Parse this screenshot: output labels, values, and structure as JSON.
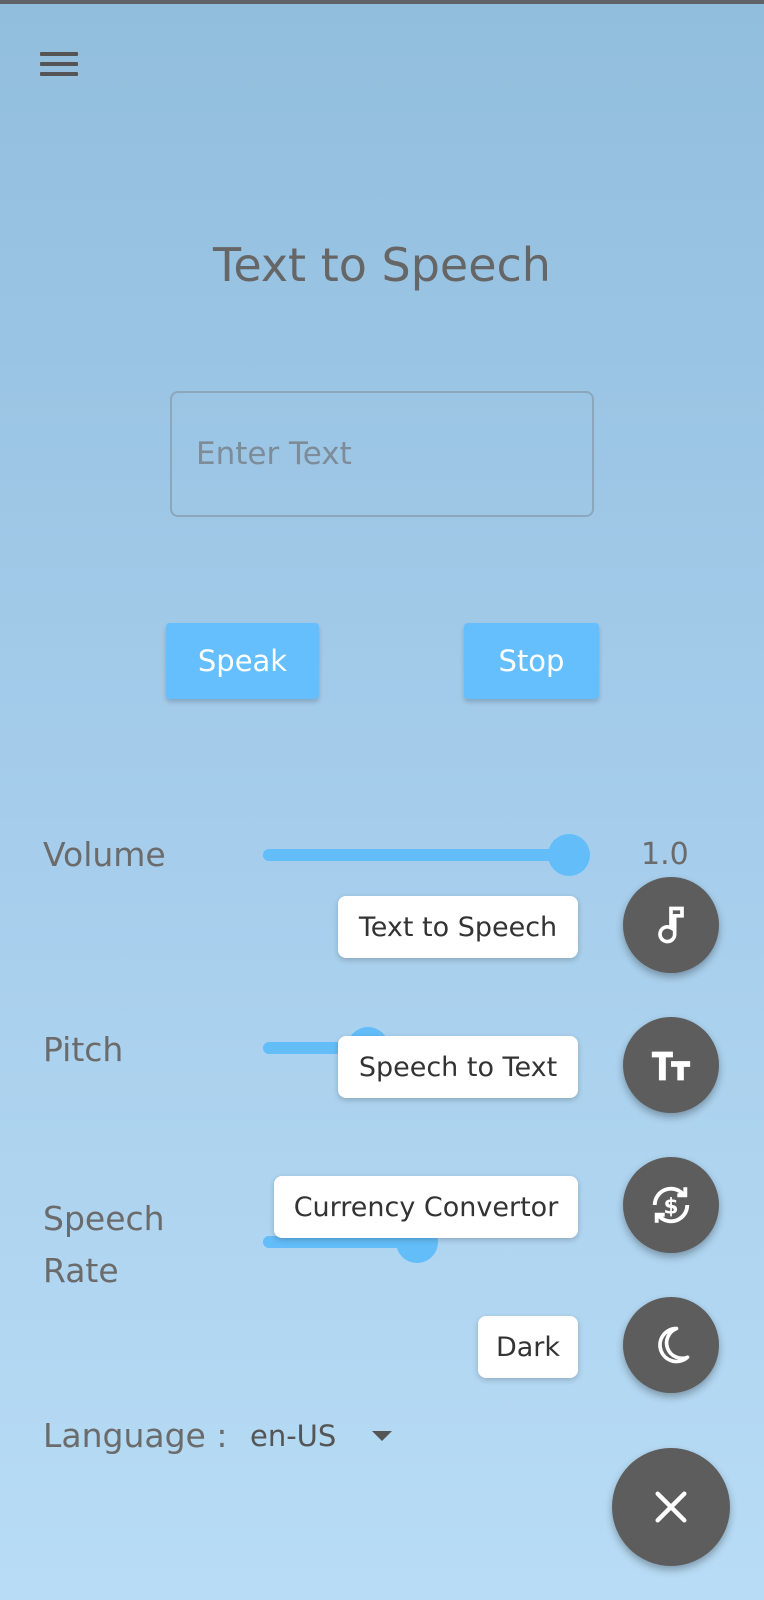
{
  "title": "Text to Speech",
  "input": {
    "placeholder": "Enter Text",
    "value": ""
  },
  "buttons": {
    "speak": "Speak",
    "stop": "Stop"
  },
  "sliders": {
    "volume": {
      "label": "Volume",
      "value": "1.0",
      "fraction": 1.0
    },
    "pitch": {
      "label": "Pitch",
      "fraction": 0.3
    },
    "rate": {
      "label_line1": "Speech",
      "label_line2": "Rate",
      "fraction": 0.5
    }
  },
  "language": {
    "label": "Language :",
    "value": "en-US"
  },
  "speed_dial": [
    {
      "label": "Text to Speech",
      "icon": "music-note-icon"
    },
    {
      "label": "Speech to Text",
      "icon": "text-size-icon"
    },
    {
      "label": "Currency Convertor",
      "icon": "currency-exchange-icon"
    },
    {
      "label": "Dark",
      "icon": "moon-icon"
    }
  ],
  "colors": {
    "accent": "#62bdf8",
    "fab": "#5d5d5d",
    "background_top": "#92bedd",
    "background_bottom": "#b8dcf5"
  }
}
